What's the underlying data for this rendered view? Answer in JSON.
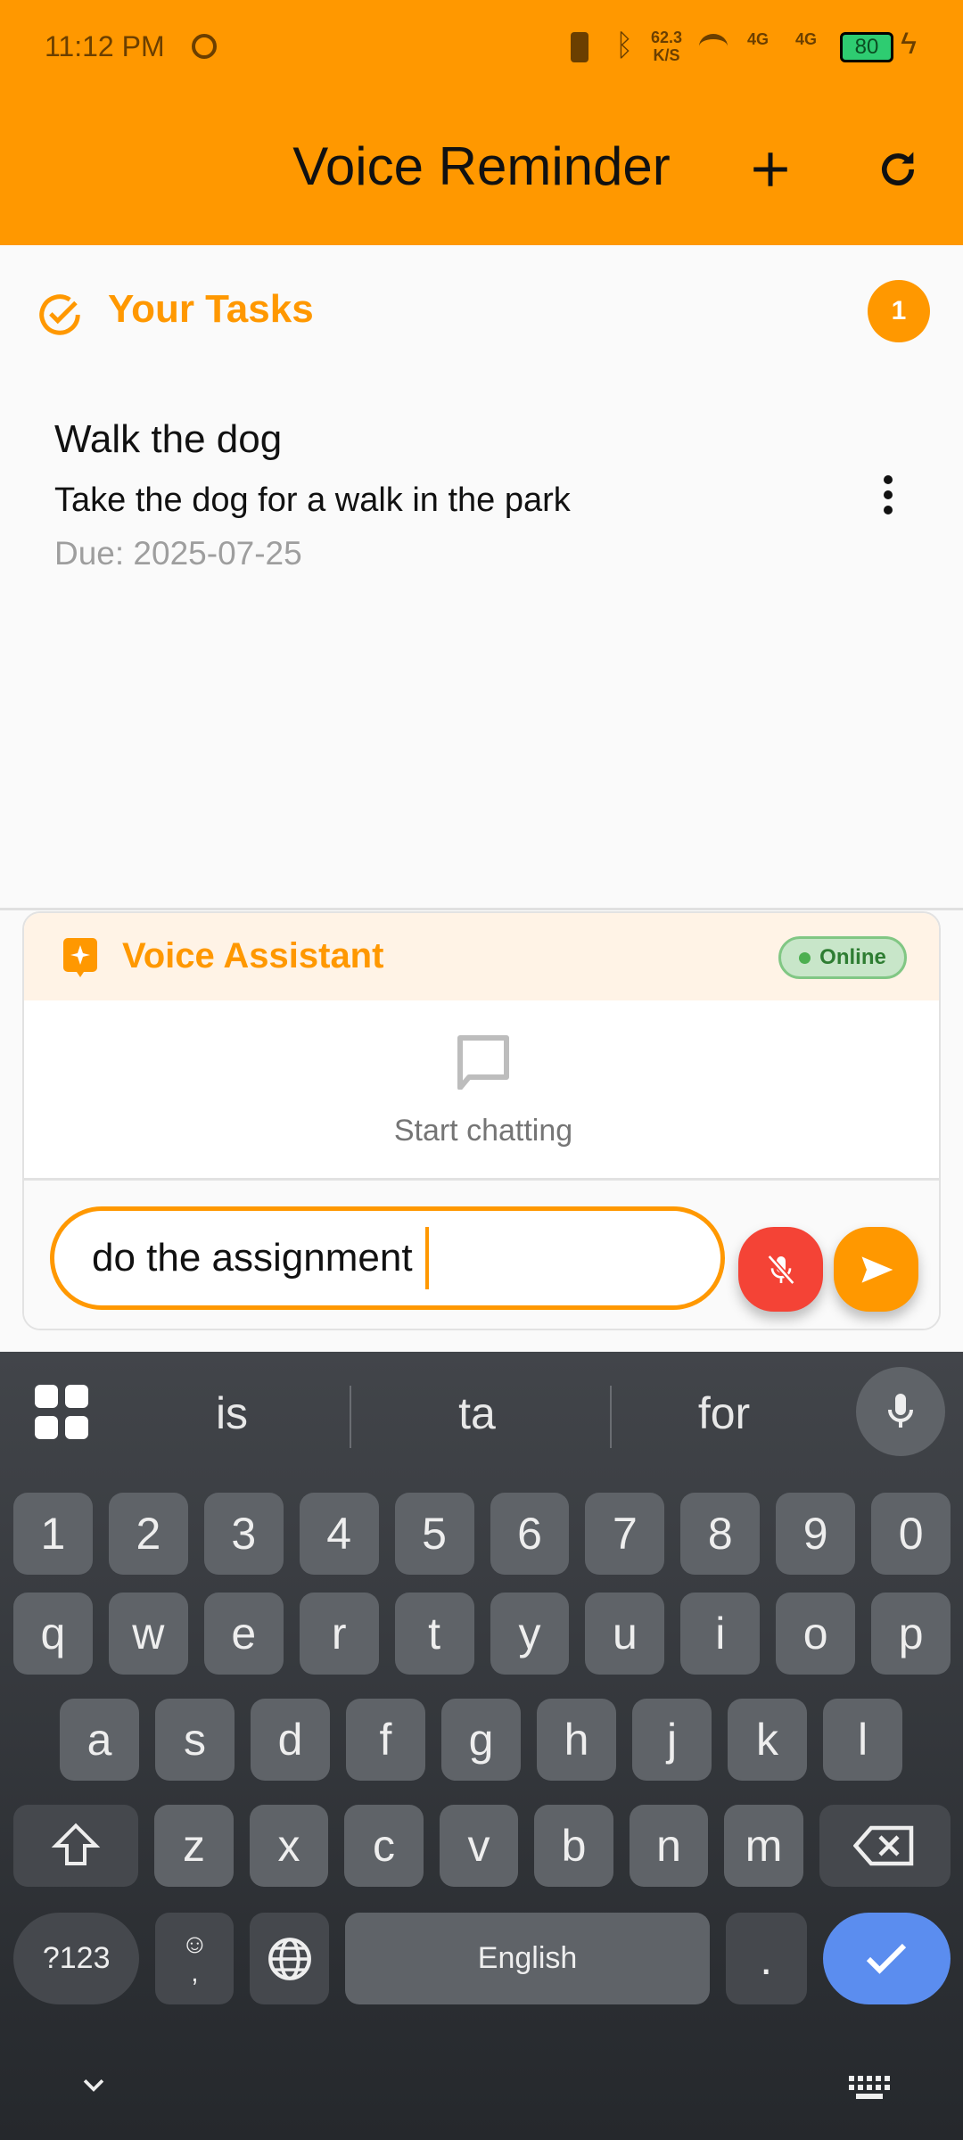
{
  "status_bar": {
    "time": "11:12 PM",
    "net_speed": "62.3",
    "net_unit": "K/S",
    "signal1": "4G",
    "signal2": "4G",
    "battery": "80"
  },
  "app_bar": {
    "title": "Voice Reminder",
    "add_icon": "plus-icon",
    "refresh_icon": "refresh-icon"
  },
  "tasks": {
    "header": "Your Tasks",
    "count": "1",
    "items": [
      {
        "title": "Walk the dog",
        "description": "Take the dog for a walk in the park",
        "due": "Due: 2025-07-25"
      }
    ]
  },
  "assistant": {
    "title": "Voice Assistant",
    "status": "Online",
    "empty_text": "Start chatting",
    "input_value": "do the assignment"
  },
  "colors": {
    "accent": "#FF9800",
    "mic": "#F44336",
    "online": "#4CAF50",
    "enter": "#5B8DEF"
  },
  "keyboard": {
    "suggestions": [
      "is",
      "ta",
      "for"
    ],
    "row1": [
      "1",
      "2",
      "3",
      "4",
      "5",
      "6",
      "7",
      "8",
      "9",
      "0"
    ],
    "row2": [
      "q",
      "w",
      "e",
      "r",
      "t",
      "y",
      "u",
      "i",
      "o",
      "p"
    ],
    "row3": [
      "a",
      "s",
      "d",
      "f",
      "g",
      "h",
      "j",
      "k",
      "l"
    ],
    "row4": [
      "z",
      "x",
      "c",
      "v",
      "b",
      "n",
      "m"
    ],
    "symbols": "?123",
    "emoji_comma": ",",
    "space": "English",
    "period": "."
  }
}
